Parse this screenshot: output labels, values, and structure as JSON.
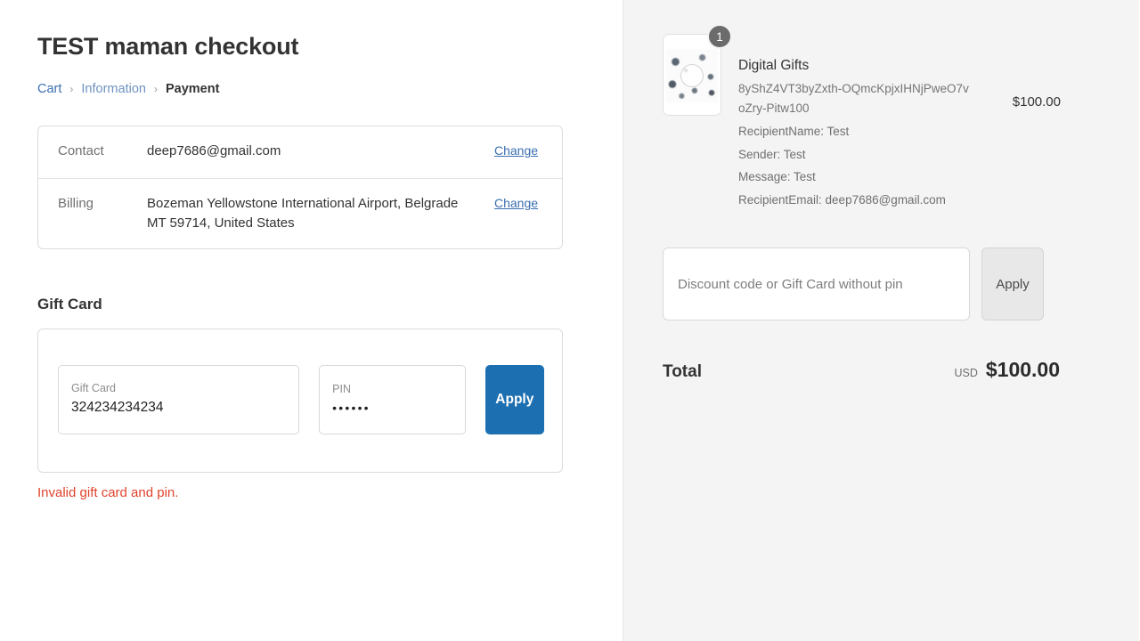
{
  "theme": {
    "accent_blue": "#1c6fb0",
    "link_blue": "#3a6fb0",
    "error_red": "#e0432c",
    "panel_bg": "#f4f4f4",
    "badge_gray": "#6b6b6b"
  },
  "checkout": {
    "title": "TEST maman checkout",
    "breadcrumb": {
      "cart": "Cart",
      "information": "Information",
      "payment": "Payment",
      "separator": "›"
    },
    "review": {
      "contact_label": "Contact",
      "contact_value": "deep7686@gmail.com",
      "contact_change": "Change",
      "billing_label": "Billing",
      "billing_value": "Bozeman Yellowstone International Airport, Belgrade MT 59714, United States",
      "billing_change": "Change"
    },
    "gift_card": {
      "heading": "Gift Card",
      "card_label": "Gift Card",
      "card_value": "324234234234",
      "pin_label": "PIN",
      "pin_value": "••••••",
      "apply_label": "Apply",
      "error": "Invalid gift card and pin."
    }
  },
  "summary": {
    "line_items": [
      {
        "title": "Digital Gifts",
        "variant": "8yShZ4VT3byZxth-OQmcKpjxIHNjPweO7voZry-Pitw100",
        "quantity": "1",
        "price": "$100.00",
        "properties": [
          "RecipientName: Test",
          "Sender: Test",
          "Message: Test",
          "RecipientEmail: deep7686@gmail.com"
        ]
      }
    ],
    "discount": {
      "placeholder": "Discount code or Gift Card without pin",
      "value": "",
      "apply_label": "Apply"
    },
    "total": {
      "label": "Total",
      "currency": "USD",
      "amount": "$100.00"
    }
  }
}
